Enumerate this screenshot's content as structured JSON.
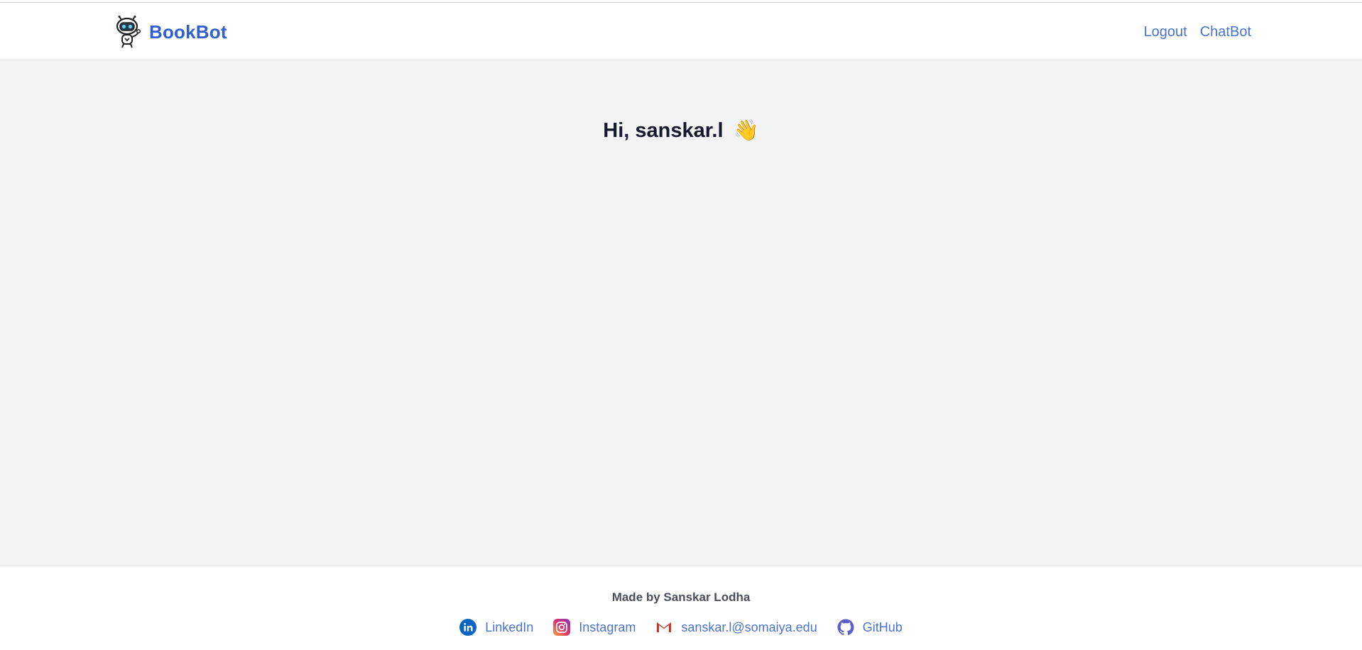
{
  "header": {
    "brand_name": "BookBot",
    "logo_icon": "robot-icon",
    "brand_color": "#2f5fd0",
    "nav": [
      {
        "label": "Logout"
      },
      {
        "label": "ChatBot"
      }
    ]
  },
  "main": {
    "greeting": "Hi, sanskar.l",
    "greeting_emoji": "👋"
  },
  "footer": {
    "made_by": "Made by Sanskar Lodha",
    "links": [
      {
        "label": "LinkedIn",
        "icon": "linkedin-icon"
      },
      {
        "label": "Instagram",
        "icon": "instagram-icon"
      },
      {
        "label": "sanskar.l@somaiya.edu",
        "icon": "gmail-icon"
      },
      {
        "label": "GitHub",
        "icon": "github-icon"
      }
    ]
  },
  "colors": {
    "background": "#f2f3f5",
    "link": "#4a73d3",
    "text": "#151a2b"
  }
}
